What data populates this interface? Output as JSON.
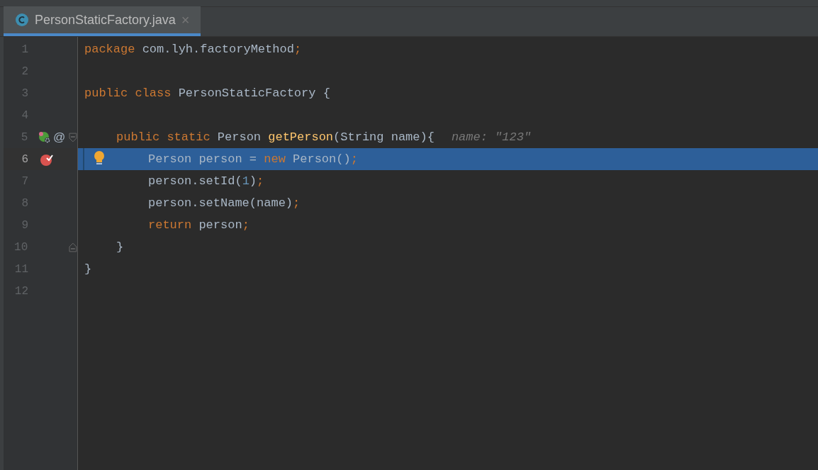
{
  "tabs": [
    {
      "label": "PersonStaticFactory.java",
      "selected": true,
      "close": "×"
    }
  ],
  "editor": {
    "lines": [
      {
        "number": "1",
        "selected": false,
        "implements": false,
        "breakpoint": false,
        "intention": false,
        "fold_start": false,
        "fold_end": false,
        "tokens": [
          {
            "kind": "keyword",
            "text": "package "
          },
          {
            "kind": "plain",
            "text": "com.lyh.factoryMethod"
          },
          {
            "kind": "keyword",
            "text": ";"
          }
        ]
      },
      {
        "number": "2",
        "selected": false,
        "implements": false,
        "breakpoint": false,
        "intention": false,
        "fold_start": false,
        "fold_end": false
      },
      {
        "number": "3",
        "selected": false,
        "implements": false,
        "breakpoint": false,
        "intention": false,
        "fold_start": false,
        "fold_end": false,
        "tokens": [
          {
            "kind": "keyword",
            "text": "public class "
          },
          {
            "kind": "plain",
            "text": "PersonStaticFactory {"
          }
        ],
        "children": [
          {
            "number": "4",
            "selected": false,
            "implements": false,
            "breakpoint": false,
            "intention": false,
            "fold_start": false,
            "fold_end": false
          },
          {
            "number": "5",
            "selected": false,
            "implements": true,
            "annotation": "@",
            "breakpoint": false,
            "intention": false,
            "fold_start": true,
            "fold_end": false,
            "tokens": [
              {
                "kind": "keyword",
                "text": "public static "
              },
              {
                "kind": "plain",
                "text": "Person "
              },
              {
                "kind": "method",
                "text": "getPerson"
              },
              {
                "kind": "plain",
                "text": "(String name){"
              },
              {
                "kind": "hint",
                "text": "name: \"123\""
              }
            ],
            "children": [
              {
                "number": "6",
                "selected": true,
                "implements": false,
                "breakpoint": true,
                "intention": true,
                "fold_start": false,
                "fold_end": false,
                "tokens": [
                  {
                    "kind": "plain",
                    "text": "Person person = "
                  },
                  {
                    "kind": "keyword",
                    "text": "new "
                  },
                  {
                    "kind": "plain",
                    "text": "Person()"
                  },
                  {
                    "kind": "keyword",
                    "text": ";"
                  }
                ]
              },
              {
                "number": "7",
                "selected": false,
                "implements": false,
                "breakpoint": false,
                "intention": false,
                "fold_start": false,
                "fold_end": false,
                "tokens": [
                  {
                    "kind": "plain",
                    "text": "person.setId("
                  },
                  {
                    "kind": "number",
                    "text": "1"
                  },
                  {
                    "kind": "plain",
                    "text": ")"
                  },
                  {
                    "kind": "keyword",
                    "text": ";"
                  }
                ]
              },
              {
                "number": "8",
                "selected": false,
                "implements": false,
                "breakpoint": false,
                "intention": false,
                "fold_start": false,
                "fold_end": false,
                "tokens": [
                  {
                    "kind": "plain",
                    "text": "person.setName(name)"
                  },
                  {
                    "kind": "keyword",
                    "text": ";"
                  }
                ]
              },
              {
                "number": "9",
                "selected": false,
                "implements": false,
                "breakpoint": false,
                "intention": false,
                "fold_start": false,
                "fold_end": false,
                "tokens": [
                  {
                    "kind": "keyword",
                    "text": "return "
                  },
                  {
                    "kind": "plain",
                    "text": "person"
                  },
                  {
                    "kind": "keyword",
                    "text": ";"
                  }
                ]
              }
            ]
          },
          {
            "number": "10",
            "selected": false,
            "implements": false,
            "breakpoint": false,
            "intention": false,
            "fold_start": false,
            "fold_end": true,
            "tokens": [
              {
                "kind": "plain",
                "text": "}"
              }
            ]
          }
        ]
      },
      {
        "number": "11",
        "selected": false,
        "implements": false,
        "breakpoint": false,
        "intention": false,
        "fold_start": false,
        "fold_end": false,
        "tokens": [
          {
            "kind": "plain",
            "text": "}"
          }
        ]
      },
      {
        "number": "12",
        "selected": false,
        "implements": false,
        "breakpoint": false,
        "intention": false,
        "fold_start": false,
        "fold_end": false
      }
    ]
  }
}
